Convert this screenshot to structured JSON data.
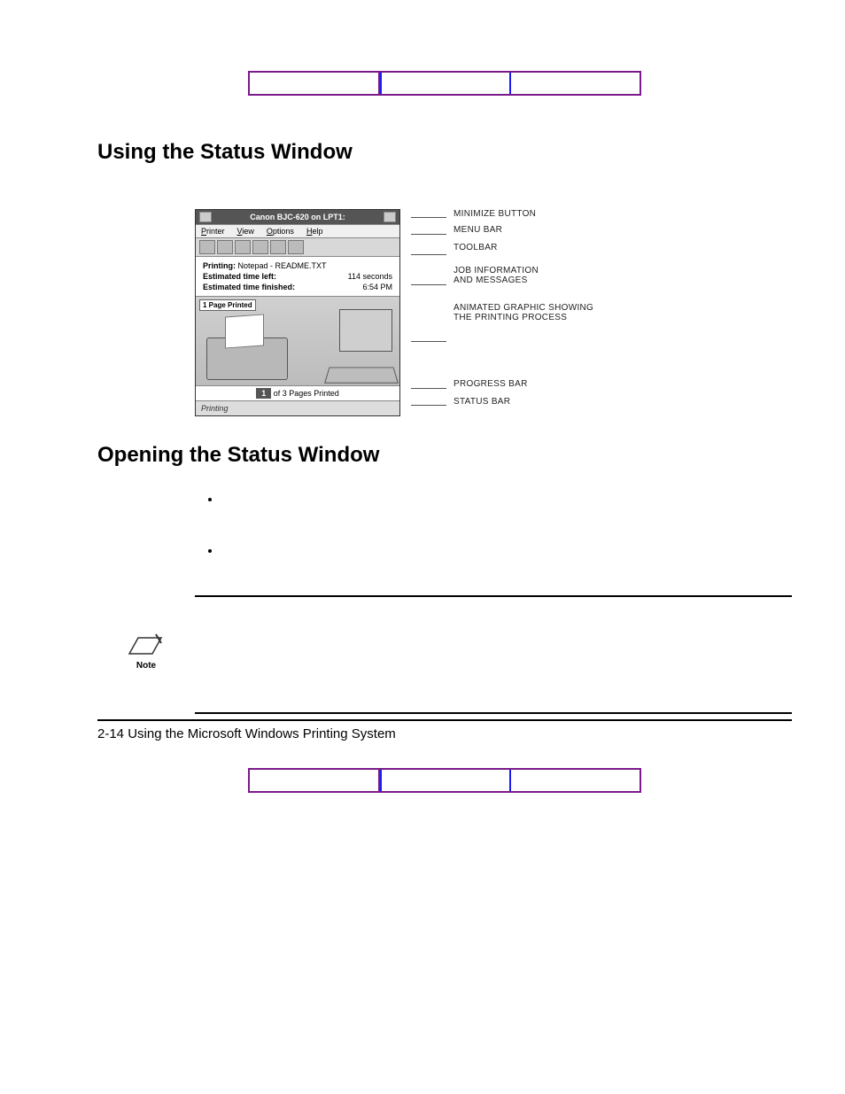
{
  "headings": {
    "h1": "Using the Status Window",
    "h2": "Opening the Status Window"
  },
  "statusWindow": {
    "title": "Canon BJC-620 on LPT1:",
    "menu": {
      "printer": "Printer",
      "view": "View",
      "options": "Options",
      "help": "Help"
    },
    "job": {
      "printingLabel": "Printing:",
      "printingValue": "Notepad - README.TXT",
      "etlLabel": "Estimated time left:",
      "etlValue": "114 seconds",
      "etfLabel": "Estimated time finished:",
      "etfValue": "6:54 PM"
    },
    "graphicTag": "1 Page Printed",
    "progress": {
      "count": "1",
      "text": " of 3 Pages Printed"
    },
    "status": "Printing"
  },
  "callouts": {
    "minimize": "MINIMIZE BUTTON",
    "menubar": "MENU BAR",
    "toolbar": "TOOLBAR",
    "jobinfo1": "JOB INFORMATION",
    "jobinfo2": "AND MESSAGES",
    "graphic1": "ANIMATED GRAPHIC SHOWING",
    "graphic2": "THE PRINTING PROCESS",
    "progress": "PROGRESS BAR",
    "status": "STATUS BAR"
  },
  "note": {
    "label": "Note"
  },
  "footer": "2-14 Using the Microsoft Windows Printing System"
}
